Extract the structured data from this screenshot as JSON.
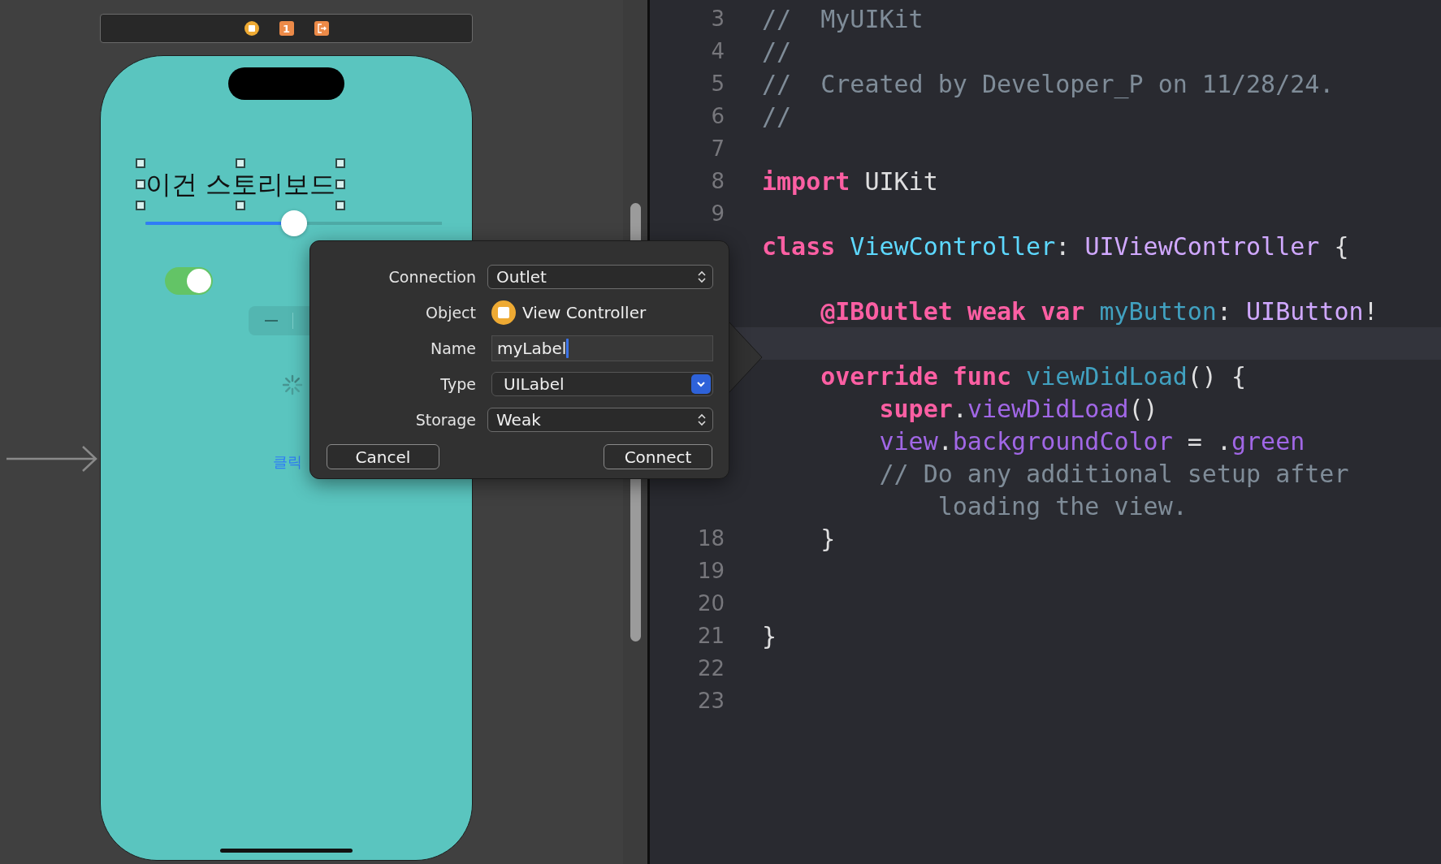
{
  "scene_dock": {
    "items": [
      {
        "kind": "view-controller"
      },
      {
        "kind": "first-responder",
        "text": "1"
      },
      {
        "kind": "exit"
      }
    ]
  },
  "phone": {
    "label": "이건 스토리보드",
    "label_selected": true,
    "slider": {
      "level": 0.5
    },
    "switch": {
      "on": true
    },
    "button": "클릭"
  },
  "dialog": {
    "fields": [
      {
        "label": "Connection",
        "kind": "popup",
        "value": "Outlet"
      },
      {
        "label": "Object",
        "kind": "object",
        "value": "View Controller"
      },
      {
        "label": "Name",
        "kind": "text",
        "value": "myLabel"
      },
      {
        "label": "Type",
        "kind": "combo",
        "value": "UILabel"
      },
      {
        "label": "Storage",
        "kind": "popup",
        "value": "Weak"
      }
    ],
    "buttons": [
      "Cancel",
      "Connect"
    ]
  },
  "editor": {
    "lines": [
      {
        "number": "3",
        "current": false,
        "tokens": [
          {
            "kind": "comment",
            "text": "//  MyUIKit"
          }
        ]
      },
      {
        "number": "4",
        "current": false,
        "tokens": [
          {
            "kind": "comment",
            "text": "//"
          }
        ]
      },
      {
        "number": "5",
        "current": false,
        "tokens": [
          {
            "kind": "comment",
            "text": "//  Created by Developer_P on 11/28/24."
          }
        ]
      },
      {
        "number": "6",
        "current": false,
        "tokens": [
          {
            "kind": "comment",
            "text": "//"
          }
        ]
      },
      {
        "number": "7",
        "current": false
      },
      {
        "number": "8",
        "current": false,
        "tokens": [
          {
            "kind": "keyword",
            "text": "import"
          },
          {
            "kind": "plain",
            "text": " UIKit"
          }
        ]
      },
      {
        "number": "9",
        "current": false
      },
      {
        "current": false,
        "tokens": [
          {
            "kind": "keyword",
            "text": "class"
          },
          {
            "kind": "decl",
            "text": " ViewController"
          },
          {
            "kind": "plain",
            "text": ": "
          },
          {
            "kind": "type",
            "text": "UIViewController"
          },
          {
            "kind": "plain",
            "text": " {"
          }
        ]
      },
      {
        "current": false
      },
      {
        "current": false,
        "tokens": [
          {
            "kind": "keyword",
            "text": "    @IBOutlet weak var"
          },
          {
            "kind": "name",
            "text": " myButton"
          },
          {
            "kind": "plain",
            "text": ": "
          },
          {
            "kind": "type",
            "text": "UIButton"
          },
          {
            "kind": "plain",
            "text": "!"
          }
        ]
      },
      {
        "current": true
      },
      {
        "current": false,
        "tokens": [
          {
            "kind": "keyword",
            "text": "    override func"
          },
          {
            "kind": "name",
            "text": " viewDidLoad"
          },
          {
            "kind": "plain",
            "text": "() {"
          }
        ]
      },
      {
        "current": false,
        "tokens": [
          {
            "kind": "keyword",
            "text": "        super"
          },
          {
            "kind": "plain",
            "text": "."
          },
          {
            "kind": "member",
            "text": "viewDidLoad"
          },
          {
            "kind": "plain",
            "text": "()"
          }
        ]
      },
      {
        "current": false,
        "tokens": [
          {
            "kind": "member",
            "text": "        view"
          },
          {
            "kind": "plain",
            "text": "."
          },
          {
            "kind": "member",
            "text": "backgroundColor"
          },
          {
            "kind": "plain",
            "text": " = ."
          },
          {
            "kind": "member",
            "text": "green"
          }
        ]
      },
      {
        "current": false,
        "tokens": [
          {
            "kind": "comment",
            "text": "        // Do any additional setup after"
          }
        ],
        "continuation": "            loading the view."
      },
      {
        "number": "18",
        "current": false,
        "tokens": [
          {
            "kind": "plain",
            "text": "    }"
          }
        ]
      },
      {
        "number": "19",
        "current": false
      },
      {
        "number": "20",
        "current": false
      },
      {
        "number": "21",
        "current": false,
        "tokens": [
          {
            "kind": "plain",
            "text": "}"
          }
        ]
      },
      {
        "number": "22",
        "current": false
      },
      {
        "number": "23",
        "current": false
      }
    ]
  }
}
